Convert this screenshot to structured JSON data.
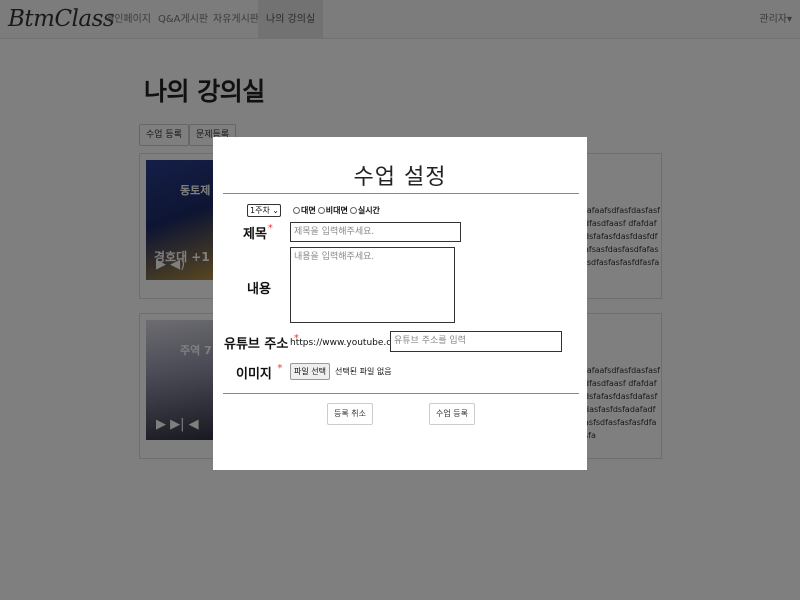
{
  "navbar": {
    "brand": "BtmClass",
    "items": [
      {
        "label": "메인페이지"
      },
      {
        "label": "Q&A게시판"
      },
      {
        "label": "자유게시판"
      },
      {
        "label": "나의 강의실"
      }
    ],
    "user_menu": "관리자▾"
  },
  "page": {
    "title": "나의 강의실",
    "add_class_button": "수업 등록",
    "add_question_button": "문제등록",
    "cards": [
      {
        "thumb_caption": "경호대 +1",
        "thumb_title": "동토제",
        "description": "fafaafsdfasfdasfasfdfasdfaasf dfafdafdsfafasfdasfdasfdfafsasfdasfasdfafasfsdfasfasfasfdfasfa"
      },
      {
        "thumb_title": "주역 7",
        "description": "fafaafsdfasfdasfasfdfasdfaasf dfafdafdsfafasfdasfdafasfdasfasfdsfadafadfasfsdfasfasfasfdfasfa"
      }
    ]
  },
  "modal": {
    "title": "수업 설정",
    "week_select": "1주차",
    "radios": [
      "대면",
      "비대면",
      "실시간"
    ],
    "title_label": "제목",
    "title_placeholder": "제목을 입력해주세요.",
    "content_label": "내용",
    "content_placeholder": "내용을 입력해주세요.",
    "youtube_label": "유튜브 주소",
    "youtube_prefix": "https://www.youtube.com/",
    "youtube_placeholder": "유튜브 주소를 입력",
    "image_label": "이미지",
    "file_button": "파일 선택",
    "file_status": "선택된 파일 없음",
    "cancel_button": "등록 취소",
    "submit_button": "수업 등록",
    "required_mark": "*"
  }
}
